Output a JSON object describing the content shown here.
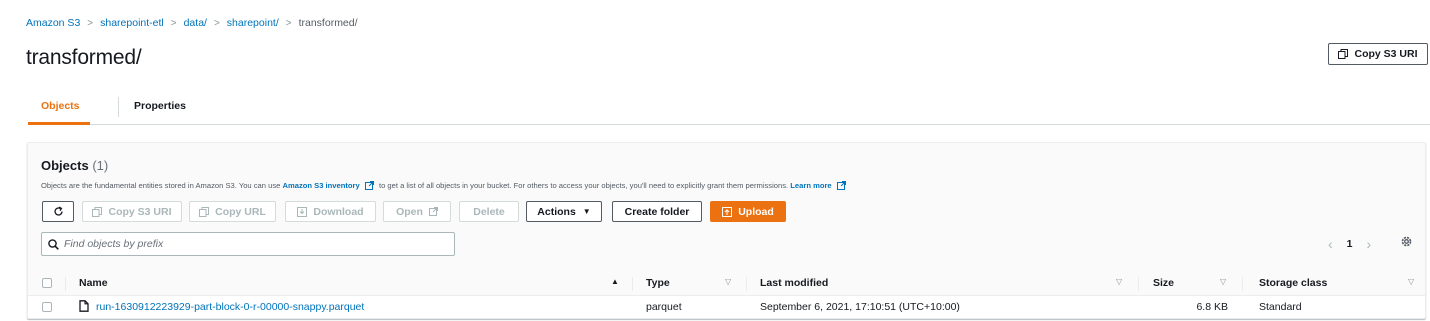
{
  "breadcrumb": {
    "items": [
      "Amazon S3",
      "sharepoint-etl",
      "data/",
      "sharepoint/"
    ],
    "current": "transformed/"
  },
  "page": {
    "title": "transformed/",
    "copy_s3_uri_label": "Copy S3 URI"
  },
  "tabs": [
    {
      "label": "Objects",
      "active": true
    },
    {
      "label": "Properties",
      "active": false
    }
  ],
  "objects": {
    "heading": "Objects",
    "count": "(1)",
    "description": {
      "before": "Objects are the fundamental entities stored in Amazon S3. You can use",
      "link1": "Amazon S3 inventory",
      "middle": "to get a list of all objects in your bucket. For others to access your objects, you'll need to explicitly grant them permissions.",
      "link2": "Learn more"
    },
    "toolbar": {
      "refresh_icon": "refresh-icon",
      "copy_s3_uri": "Copy S3 URI",
      "copy_url": "Copy URL",
      "download": "Download",
      "open": "Open",
      "delete": "Delete",
      "actions": "Actions",
      "create_folder": "Create folder",
      "upload": "Upload"
    },
    "search": {
      "placeholder": "Find objects by prefix",
      "value": ""
    },
    "pagination": {
      "current_page": "1"
    },
    "columns": {
      "name": "Name",
      "type": "Type",
      "last_modified": "Last modified",
      "size": "Size",
      "storage_class": "Storage class"
    },
    "rows": [
      {
        "name": "run-1630912223929-part-block-0-r-00000-snappy.parquet",
        "type": "parquet",
        "last_modified": "September 6, 2021, 17:10:51 (UTC+10:00)",
        "size": "6.8 KB",
        "storage_class": "Standard"
      }
    ]
  },
  "colors": {
    "link": "#0073bb",
    "accent": "#ec7211",
    "text": "#16191f",
    "muted": "#545b64",
    "disabled": "#aab7b8"
  }
}
